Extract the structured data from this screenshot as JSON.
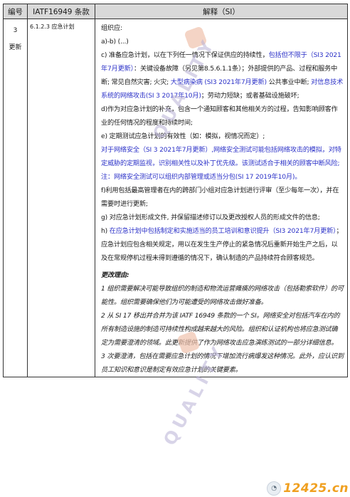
{
  "table": {
    "headers": [
      "编号",
      "IATF16949 条款",
      "解释（SI）"
    ],
    "row": {
      "number": "3",
      "status": "更新",
      "clause": "6.1.2.3 应急计划"
    }
  },
  "body": {
    "line_org": "组织应:",
    "line_ab": "a)-b) (...)",
    "c_lead": "c) 准备应急计划，以在下列任一情况下保证供应的持续性，",
    "c_blue1": "包括但不限于（SI3 2021年7月更新）",
    "c_text1": "：关键设备故障（另见第8.5.6.1.1条）；外部提供的产品、过程和服务中断; 常见自然灾害; 火灾; ",
    "c_blue2": "大型病染病 (SI3 2021年7月更新)",
    "c_text2": " 公共事业中断; ",
    "c_blue3": "对信息技术系统的网络攻击(SI 3 2017年10月)",
    "c_text3": "；劳动力短缺；或者基础设施破坏;",
    "d": "d)作为对应急计划的补充，包含一个通知顾客和其他相关方的过程，告知影响顾客作业的任何情况的程度和持续时间;",
    "e": "e) 定期测试应急计划的有效性（如：模拟，视情况而定）;",
    "e_blue": "对于网络安全（SI 3 2021年7月更新）,网络安全测试可能包括网络攻击的模拟，对特定威胁的定期监视，识别相关性以及补丁优先级。该测试适合于相关的顾客中断风险;",
    "note_blue": "注：网络安全测试可以组织内部管理或适当分包(SI 17 2019年10月)。",
    "f": "f)利用包括最高管理者在内的跨部门小组对应急计划进行评审（至少每年一次），并在需要时进行更新;",
    "g": "g) 对应急计划形成文件, 并保留描述修订以及更改授权人员的形成文件的信息;",
    "h_lead": "h) ",
    "h_blue": "在应急计划中包括制定和实施适当的员工培训和意识提升（SI3 2021年7月更新）",
    "h_end": "；",
    "closing": "应急计划应包含相关规定，用以在发生生产停止的紧急情况后重新开始生产之后，以及在常规停机过程未得到遵循的情况下，确认制造的产品持续符合顾客规范。",
    "reasons_title": "更改理由:",
    "reasons": [
      "1 组织需要解决可能导致组织的制造和物流运营瘫痪的网络攻击（包括勒索软件）的可能性。组织需要确保他们为可能遭受的网络攻击做好准备。",
      "2 从 SI 17 移出并合并为该 IATF 16949 条款的一个 SI。网络安全对包括汽车在内的所有制造设施的制造可持续性构成越来越大的风险。组织和认证机构也将应急测试确定为需要澄清的领域。此更新提供了作为网络攻击应急演练测试的一部分详细信息。",
      "3 次要澄清，包括在需要应急计划的情况下增加流行病爆发这种情况。此外，应认识到员工知识和意识是制定有效应急计划的关键要素。"
    ]
  },
  "watermark": {
    "text": "QUALITY"
  },
  "badge": {
    "text": "12425.cn"
  }
}
